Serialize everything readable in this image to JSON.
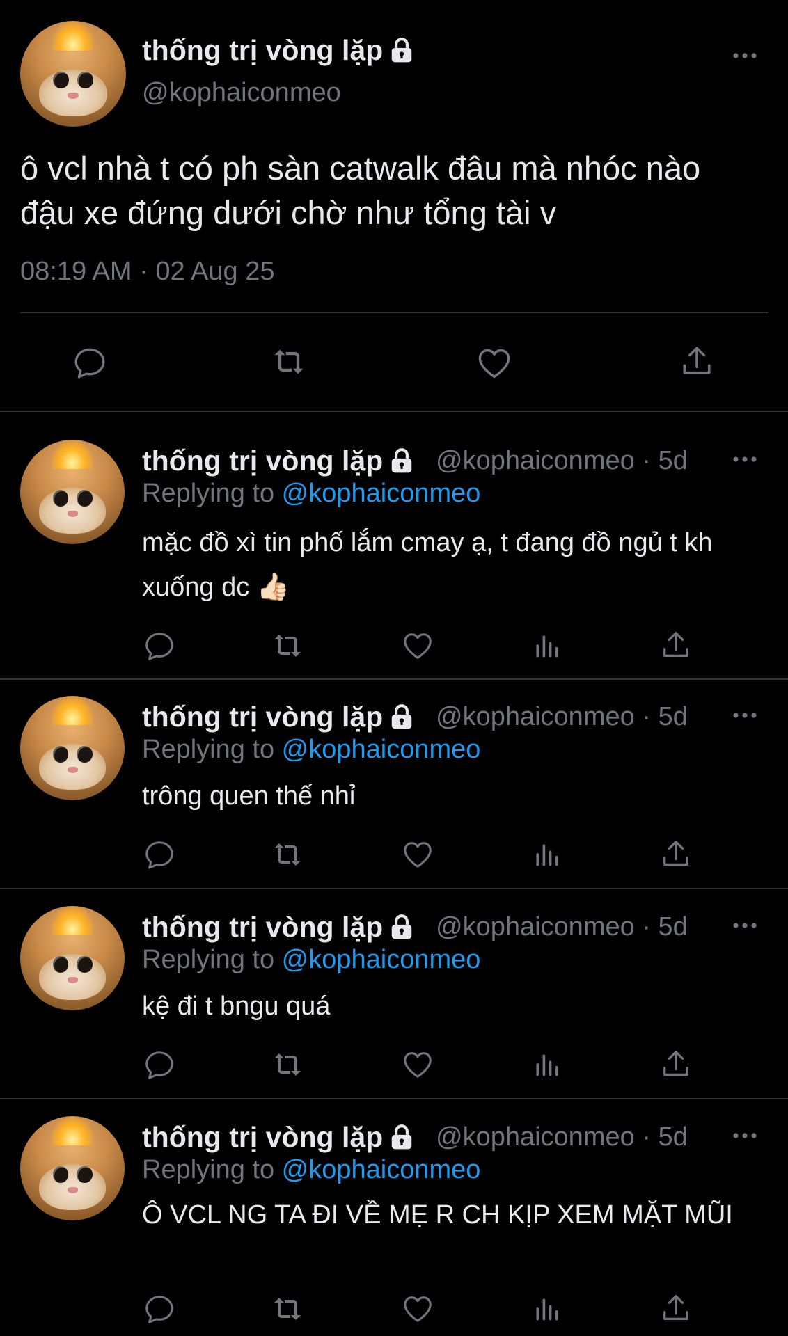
{
  "main_tweet": {
    "display_name": "thống trị vòng lặp",
    "handle": "@kophaiconmeo",
    "text": "ô vcl nhà t có ph sàn catwalk đâu mà nhóc nào đậu xe đứng dưới chờ như tổng tài v",
    "timestamp": "08:19 AM · 02 Aug 25",
    "actions": [
      "reply-icon",
      "retweet-icon",
      "like-icon",
      "share-icon"
    ]
  },
  "replies": [
    {
      "display_name": "thống trị vòng lặp",
      "handle_meta": "@kophaiconmeo · 5d",
      "replying_prefix": "Replying to ",
      "replying_handle": "@kophaiconmeo",
      "text": "mặc đồ xì tin phố lắm cmay ạ, t đang đồ ngủ t kh xuống dc 👍🏻"
    },
    {
      "display_name": "thống trị vòng lặp",
      "handle_meta": "@kophaiconmeo · 5d",
      "replying_prefix": "Replying to ",
      "replying_handle": "@kophaiconmeo",
      "text": "trông quen thế nhỉ"
    },
    {
      "display_name": "thống trị vòng lặp",
      "handle_meta": "@kophaiconmeo · 5d",
      "replying_prefix": "Replying to ",
      "replying_handle": "@kophaiconmeo",
      "text": "kệ đi t bngu quá"
    },
    {
      "display_name": "thống trị vòng lặp",
      "handle_meta": "@kophaiconmeo · 5d",
      "replying_prefix": "Replying to ",
      "replying_handle": "@kophaiconmeo",
      "text": "Ô VCL NG TA ĐI VỀ MẸ R CH KỊP XEM MẶT MŨI"
    }
  ],
  "colors": {
    "background": "#000000",
    "text": "#e7e9ea",
    "muted": "#71767b",
    "link": "#1d9bf0",
    "divider": "#2f3336"
  }
}
